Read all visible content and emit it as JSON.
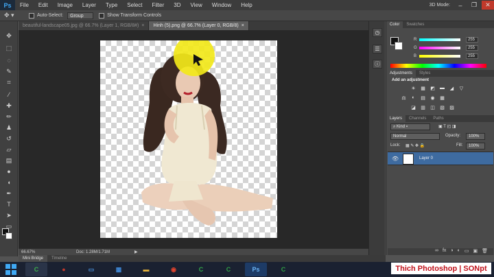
{
  "menubar": {
    "logo": "Ps",
    "items": [
      "File",
      "Edit",
      "Image",
      "Layer",
      "Type",
      "Select",
      "Filter",
      "3D",
      "View",
      "Window",
      "Help"
    ],
    "workspace_label": "3D Mode:",
    "window_buttons": [
      "–",
      "❐",
      "✕"
    ]
  },
  "options": {
    "auto_select_label": "Auto-Select:",
    "auto_select_value": "Group",
    "transform_label": "Show Transform Controls"
  },
  "tabs": [
    {
      "label": "beautiful-landscape05.jpg @ 66.7% (Layer 1, RGB/8#)",
      "close": "×",
      "active": false
    },
    {
      "label": "Hinh (5).png @ 66.7% (Layer 0, RGB/8)",
      "close": "×",
      "active": true
    }
  ],
  "status": {
    "zoom": "66.67%",
    "doc": "Doc: 1.28M/1.71M",
    "arrow": "▶"
  },
  "minibridge": {
    "tabs": [
      "Mini Bridge",
      "Timeline"
    ]
  },
  "panels": {
    "color": {
      "tabs": [
        "Color",
        "Swatches"
      ],
      "rows": [
        {
          "label": "R",
          "value": "255",
          "gradient": "#ff0000"
        },
        {
          "label": "G",
          "value": "255",
          "gradient": "#00ff00"
        },
        {
          "label": "B",
          "value": "255",
          "gradient": "#0000ff"
        }
      ]
    },
    "adjustments": {
      "tabs": [
        "Adjustments",
        "Styles"
      ],
      "title": "Add an adjustment",
      "icons": [
        "☀",
        "▦",
        "◩",
        "▬",
        "◢",
        "▽",
        "⚖",
        "◐",
        "▤",
        "◉",
        "▦",
        "◪",
        "▥",
        "◫",
        "▧",
        "▨"
      ]
    },
    "layers": {
      "tabs": [
        "Layers",
        "Channels",
        "Paths"
      ],
      "kind_label": "Kind",
      "blend_mode": "Normal",
      "opacity_label": "Opacity:",
      "opacity_value": "100%",
      "lock_label": "Lock:",
      "fill_label": "Fill:",
      "fill_value": "100%",
      "layer_name": "Layer 0",
      "footer_icons": [
        "∞",
        "fx",
        "◑",
        "◐",
        "▭",
        "▣",
        "🗑"
      ]
    }
  },
  "taskbar": {
    "caption": "Thich Photoshop | SONpt",
    "apps": [
      {
        "name": "camtasia-icon",
        "glyph": "C",
        "color": "#3cb04a"
      },
      {
        "name": "paint-icon",
        "glyph": "●",
        "color": "#c0392b"
      },
      {
        "name": "monitor-icon",
        "glyph": "▭",
        "color": "#4a8fd8"
      },
      {
        "name": "control-panel-icon",
        "glyph": "▦",
        "color": "#3f88d6"
      },
      {
        "name": "folder-icon",
        "glyph": "▬",
        "color": "#e8b43a"
      },
      {
        "name": "chrome-icon",
        "glyph": "◉",
        "color": "#e1442e"
      },
      {
        "name": "camtasia-recorder-icon",
        "glyph": "C",
        "color": "#32a84a"
      },
      {
        "name": "camtasia-editor-icon",
        "glyph": "C",
        "color": "#2f9e44"
      },
      {
        "name": "photoshop-icon",
        "glyph": "Ps",
        "color": "#1d3b66"
      },
      {
        "name": "camtasia-studio-icon",
        "glyph": "C",
        "color": "#2f9e44"
      }
    ]
  }
}
